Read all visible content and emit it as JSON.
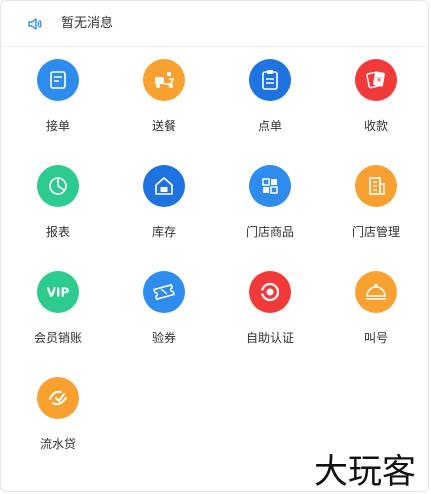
{
  "notice": {
    "text": "暂无消息",
    "icon": "speaker-icon"
  },
  "colors": {
    "blue": "#2F8CEF",
    "orange": "#F8A030",
    "red": "#F23A3A",
    "green": "#2DCB8F"
  },
  "items": [
    {
      "label": "接单",
      "icon": "receive-order-icon",
      "color": "#2F8CEF"
    },
    {
      "label": "送餐",
      "icon": "delivery-scooter-icon",
      "color": "#F8A030"
    },
    {
      "label": "点单",
      "icon": "clipboard-icon",
      "color": "#1F73E0"
    },
    {
      "label": "收款",
      "icon": "payment-tickets-icon",
      "color": "#F23A3A"
    },
    {
      "label": "报表",
      "icon": "report-chart-icon",
      "color": "#2DCB8F"
    },
    {
      "label": "库存",
      "icon": "warehouse-icon",
      "color": "#1F73E0"
    },
    {
      "label": "门店商品",
      "icon": "grid-goods-icon",
      "color": "#2F8CEF"
    },
    {
      "label": "门店管理",
      "icon": "store-building-icon",
      "color": "#F8A030"
    },
    {
      "label": "会员销账",
      "icon": "vip-icon",
      "color": "#2DCB8F"
    },
    {
      "label": "验券",
      "icon": "coupon-ticket-icon",
      "color": "#2F8CEF"
    },
    {
      "label": "自助认证",
      "icon": "self-verify-icon",
      "color": "#F23A3A"
    },
    {
      "label": "叫号",
      "icon": "service-bell-icon",
      "color": "#F8A030"
    },
    {
      "label": "流水贷",
      "icon": "loan-flow-icon",
      "color": "#F8A030"
    }
  ],
  "watermark": {
    "text": "大玩客"
  }
}
